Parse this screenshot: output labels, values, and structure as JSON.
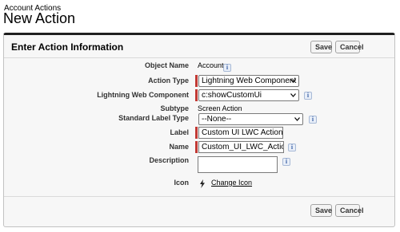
{
  "header": {
    "subtitle": "Account Actions",
    "title": "New Action"
  },
  "panel": {
    "heading": "Enter Action Information",
    "save_label": "Save",
    "cancel_label": "Cancel"
  },
  "fields": {
    "object_name": {
      "label": "Object Name",
      "value": "Account"
    },
    "action_type": {
      "label": "Action Type",
      "value": "Lightning Web Component"
    },
    "lwc": {
      "label": "Lightning Web Component",
      "value": "c:showCustomUi"
    },
    "subtype": {
      "label": "Subtype",
      "value": "Screen Action"
    },
    "standard_label_type": {
      "label": "Standard Label Type",
      "value": "--None--"
    },
    "label": {
      "label": "Label",
      "value": "Custom UI LWC Action"
    },
    "name": {
      "label": "Name",
      "value": "Custom_UI_LWC_Action"
    },
    "description": {
      "label": "Description",
      "value": ""
    },
    "icon": {
      "label": "Icon",
      "link_text": "Change Icon",
      "icon_name": "lightning-bolt-icon"
    }
  },
  "info_glyph": "i",
  "colors": {
    "required": "#c23934",
    "panel_border_top": "#1f1f1f",
    "panel_bg": "#f7f7f7"
  }
}
